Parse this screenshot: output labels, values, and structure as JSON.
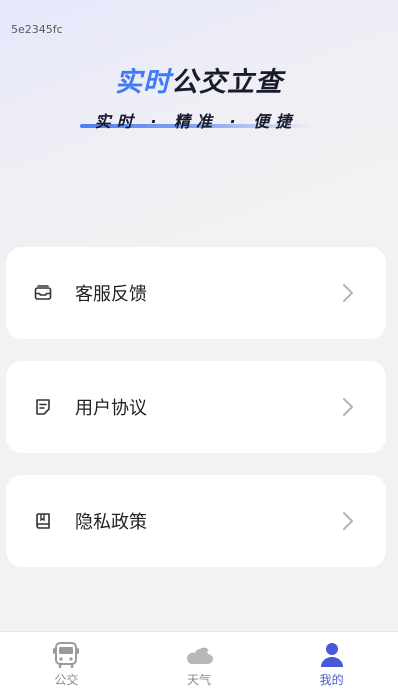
{
  "build_id": "5e2345fc",
  "hero": {
    "title_accent": "实时",
    "title_rest": "公交立查",
    "subtitle": "实时 · 精准 · 便捷"
  },
  "menu": [
    {
      "label": "客服反馈",
      "icon": "inbox-icon"
    },
    {
      "label": "用户协议",
      "icon": "note-icon"
    },
    {
      "label": "隐私政策",
      "icon": "book-icon"
    }
  ],
  "tabs": [
    {
      "label": "公交",
      "icon": "bus-icon",
      "active": false
    },
    {
      "label": "天气",
      "icon": "cloud-icon",
      "active": false
    },
    {
      "label": "我的",
      "icon": "user-icon",
      "active": true
    }
  ],
  "colors": {
    "accent": "#3f7bf6",
    "tab_active": "#4a57d6",
    "tab_inactive": "#9a9a9a"
  }
}
